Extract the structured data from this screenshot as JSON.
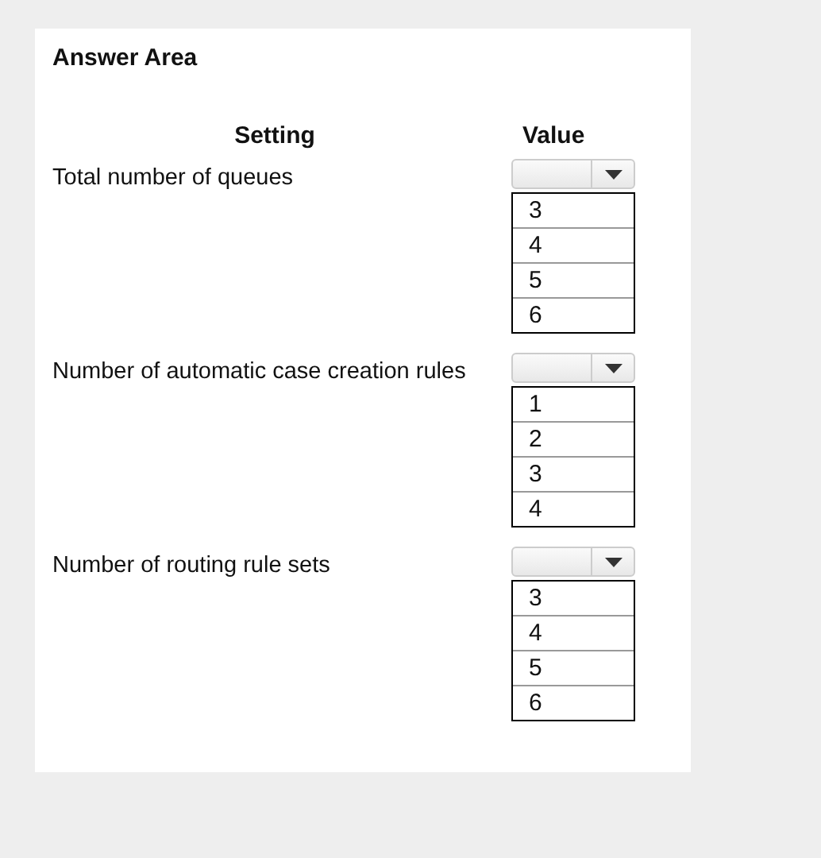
{
  "title": "Answer Area",
  "columns": [
    "Setting",
    "Value"
  ],
  "rows": [
    {
      "label": "Total number of queues",
      "options": [
        "3",
        "4",
        "5",
        "6"
      ]
    },
    {
      "label": "Number of automatic case creation rules",
      "options": [
        "1",
        "2",
        "3",
        "4"
      ]
    },
    {
      "label": "Number of routing rule sets",
      "options": [
        "3",
        "4",
        "5",
        "6"
      ]
    }
  ]
}
